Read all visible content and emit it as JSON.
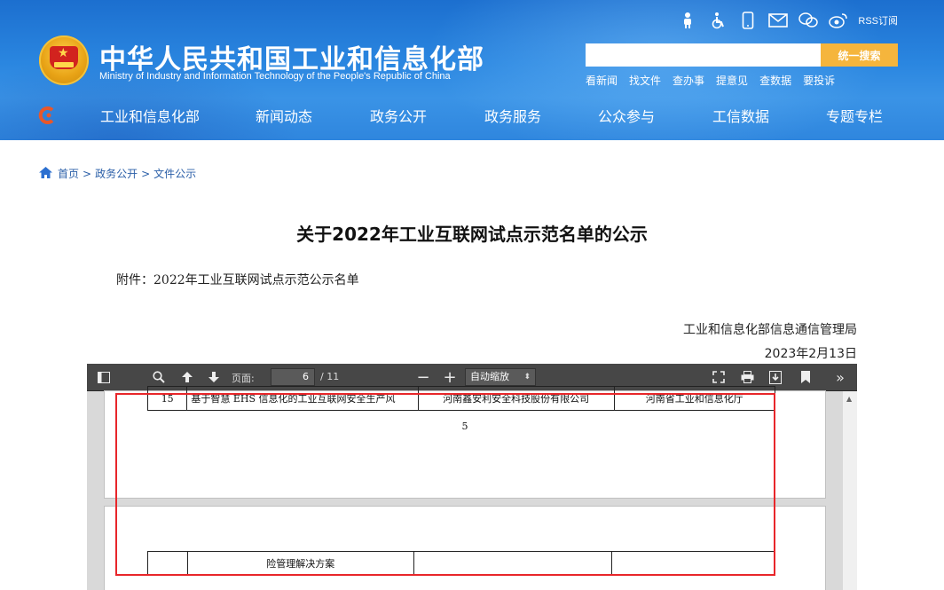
{
  "header": {
    "title": "中华人民共和国工业和信息化部",
    "subtitle": "Ministry of Industry and Information Technology of the People's Republic of China",
    "top_icons": [
      "accessibility-elder-icon",
      "wheelchair-icon",
      "mobile-icon",
      "mail-icon",
      "wechat-icon",
      "weibo-icon"
    ],
    "rss_label": "RSS订阅",
    "search": {
      "placeholder": "",
      "button_label": "统一搜索"
    },
    "quick_links": [
      "看新闻",
      "找文件",
      "查办事",
      "提意见",
      "查数据",
      "要投诉"
    ],
    "nav": [
      "工业和信息化部",
      "新闻动态",
      "政务公开",
      "政务服务",
      "公众参与",
      "工信数据",
      "专题专栏"
    ],
    "colors": {
      "header_blue": "#2a86e0",
      "search_button": "#f5b53c"
    }
  },
  "breadcrumb": {
    "home": "首页",
    "items": [
      "政务公开",
      "文件公示"
    ],
    "separator": ">"
  },
  "article": {
    "title": "关于2022年工业互联网试点示范名单的公示",
    "attachment": "附件：2022年工业互联网试点示范公示名单",
    "signer": "工业和信息化部信息通信管理局",
    "date": "2023年2月13日"
  },
  "pdf_viewer": {
    "page_label": "页面:",
    "current_page": "6",
    "total_pages": "/ 11",
    "zoom": "自动缩放",
    "page1": {
      "row": [
        "15",
        "基于智慧 EHS 信息化的工业互联网安全生产风",
        "河南鑫安利安全科技股份有限公司",
        "河南省工业和信息化厅"
      ],
      "page_number": "5"
    },
    "page2": {
      "row": [
        "",
        "险管理解决方案",
        "",
        ""
      ]
    }
  }
}
